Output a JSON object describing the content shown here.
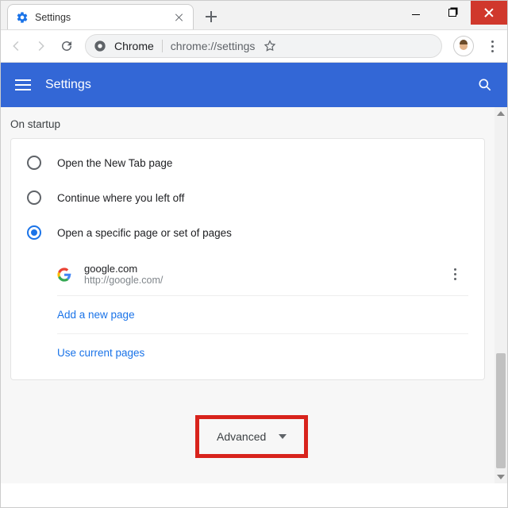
{
  "browser": {
    "tab_title": "Settings",
    "omnibox": {
      "origin": "Chrome",
      "url": "chrome://settings"
    }
  },
  "header": {
    "title": "Settings"
  },
  "section": {
    "title": "On startup",
    "options": {
      "opt1": "Open the New Tab page",
      "opt2": "Continue where you left off",
      "opt3": "Open a specific page or set of pages"
    },
    "startup_page": {
      "name": "google.com",
      "url": "http://google.com/"
    },
    "add_link": "Add a new page",
    "use_current": "Use current pages"
  },
  "advanced_label": "Advanced"
}
